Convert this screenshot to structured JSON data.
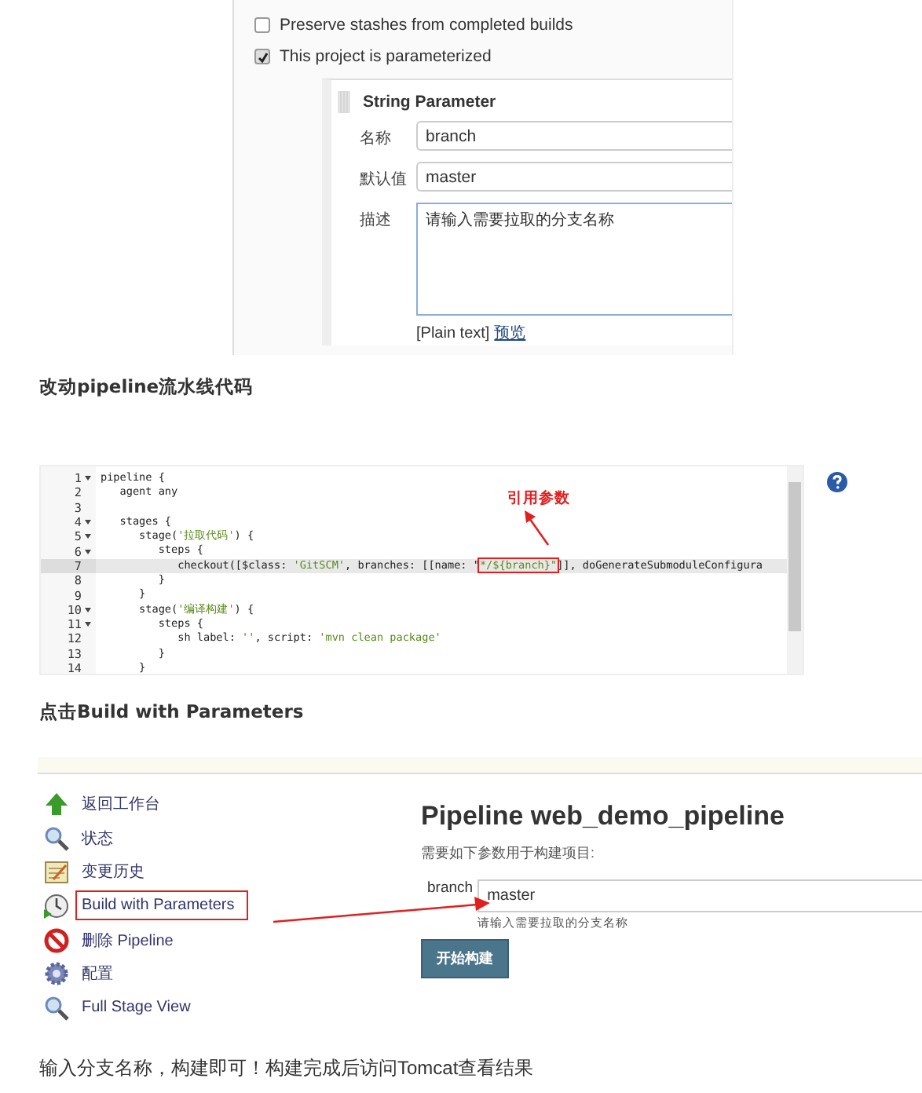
{
  "parameter_config": {
    "options": [
      {
        "label": "Preserve stashes from completed builds",
        "checked": false
      },
      {
        "label": "This project is parameterized",
        "checked": true
      }
    ],
    "parameter": {
      "title": "String Parameter",
      "fields": [
        {
          "label": "名称",
          "value": "branch",
          "kind": "input"
        },
        {
          "label": "默认值",
          "value": "master",
          "kind": "input"
        },
        {
          "label": "描述",
          "value": "请输入需要拉取的分支名称",
          "kind": "textarea"
        }
      ],
      "format_note": "[Plain text]",
      "preview_link": "预览"
    }
  },
  "heading_1": "改动pipeline流水线代码",
  "code_editor": {
    "annotation": "引用参数",
    "lines": [
      {
        "number": "1",
        "fold": true,
        "current": false,
        "segments": [
          {
            "text": "pipeline {",
            "kind": "plain"
          }
        ]
      },
      {
        "number": "2",
        "fold": false,
        "current": false,
        "segments": [
          {
            "text": "   agent any",
            "kind": "plain"
          }
        ]
      },
      {
        "number": "3",
        "fold": false,
        "current": false
      },
      {
        "number": "4",
        "fold": true,
        "current": false,
        "segments": [
          {
            "text": "   stages {",
            "kind": "plain"
          }
        ]
      },
      {
        "number": "5",
        "fold": true,
        "current": false,
        "segments": [
          {
            "text": "      stage(",
            "kind": "plain"
          },
          {
            "text": "'拉取代码'",
            "kind": "string"
          },
          {
            "text": ") {",
            "kind": "plain"
          }
        ]
      },
      {
        "number": "6",
        "fold": true,
        "current": false,
        "segments": [
          {
            "text": "         steps {",
            "kind": "plain"
          }
        ]
      },
      {
        "number": "7",
        "fold": false,
        "current": true,
        "segments": [
          {
            "text": "            checkout([$class: ",
            "kind": "plain"
          },
          {
            "text": "'GitSCM'",
            "kind": "string"
          },
          {
            "text": ", branches: [[name: \"",
            "kind": "plain"
          },
          {
            "text": "*/${branch}\"",
            "kind": "annotated"
          },
          {
            "text": "]], doGenerateSubmoduleConfigura",
            "kind": "plain"
          }
        ]
      },
      {
        "number": "8",
        "fold": false,
        "current": false,
        "segments": [
          {
            "text": "         }",
            "kind": "plain"
          }
        ]
      },
      {
        "number": "9",
        "fold": false,
        "current": false,
        "segments": [
          {
            "text": "      }",
            "kind": "plain"
          }
        ]
      },
      {
        "number": "10",
        "fold": true,
        "current": false,
        "segments": [
          {
            "text": "      stage(",
            "kind": "plain"
          },
          {
            "text": "'编译构建'",
            "kind": "string"
          },
          {
            "text": ") {",
            "kind": "plain"
          }
        ]
      },
      {
        "number": "11",
        "fold": true,
        "current": false,
        "segments": [
          {
            "text": "         steps {",
            "kind": "plain"
          }
        ]
      },
      {
        "number": "12",
        "fold": false,
        "current": false,
        "segments": [
          {
            "text": "            sh label: ",
            "kind": "plain"
          },
          {
            "text": "''",
            "kind": "string"
          },
          {
            "text": ", script: ",
            "kind": "plain"
          },
          {
            "text": "'mvn clean package'",
            "kind": "string"
          }
        ]
      },
      {
        "number": "13",
        "fold": false,
        "current": false,
        "segments": [
          {
            "text": "         }",
            "kind": "plain"
          }
        ]
      },
      {
        "number": "14",
        "fold": false,
        "current": false,
        "segments": [
          {
            "text": "      }",
            "kind": "plain"
          }
        ]
      }
    ]
  },
  "heading_2": "点击Build with Parameters",
  "jenkins_page": {
    "sidebar": [
      {
        "label": "返回工作台",
        "kind": "up",
        "annotated": false
      },
      {
        "label": "状态",
        "kind": "search",
        "annotated": false
      },
      {
        "label": "变更历史",
        "kind": "notepad",
        "annotated": false
      },
      {
        "label": "Build with Parameters",
        "kind": "clock",
        "annotated": true
      },
      {
        "label": "删除 Pipeline",
        "kind": "forbidden",
        "annotated": false
      },
      {
        "label": "配置",
        "kind": "gear",
        "annotated": false
      },
      {
        "label": "Full Stage View",
        "kind": "search",
        "annotated": false
      }
    ],
    "title": "Pipeline web_demo_pipeline",
    "subtitle": "需要如下参数用于构建项目:",
    "parameter": {
      "label": "branch",
      "value": "master",
      "hint": "请输入需要拉取的分支名称"
    },
    "build_button": "开始构建"
  },
  "caption": "输入分支名称，构建即可！构建完成后访问Tomcat查看结果"
}
